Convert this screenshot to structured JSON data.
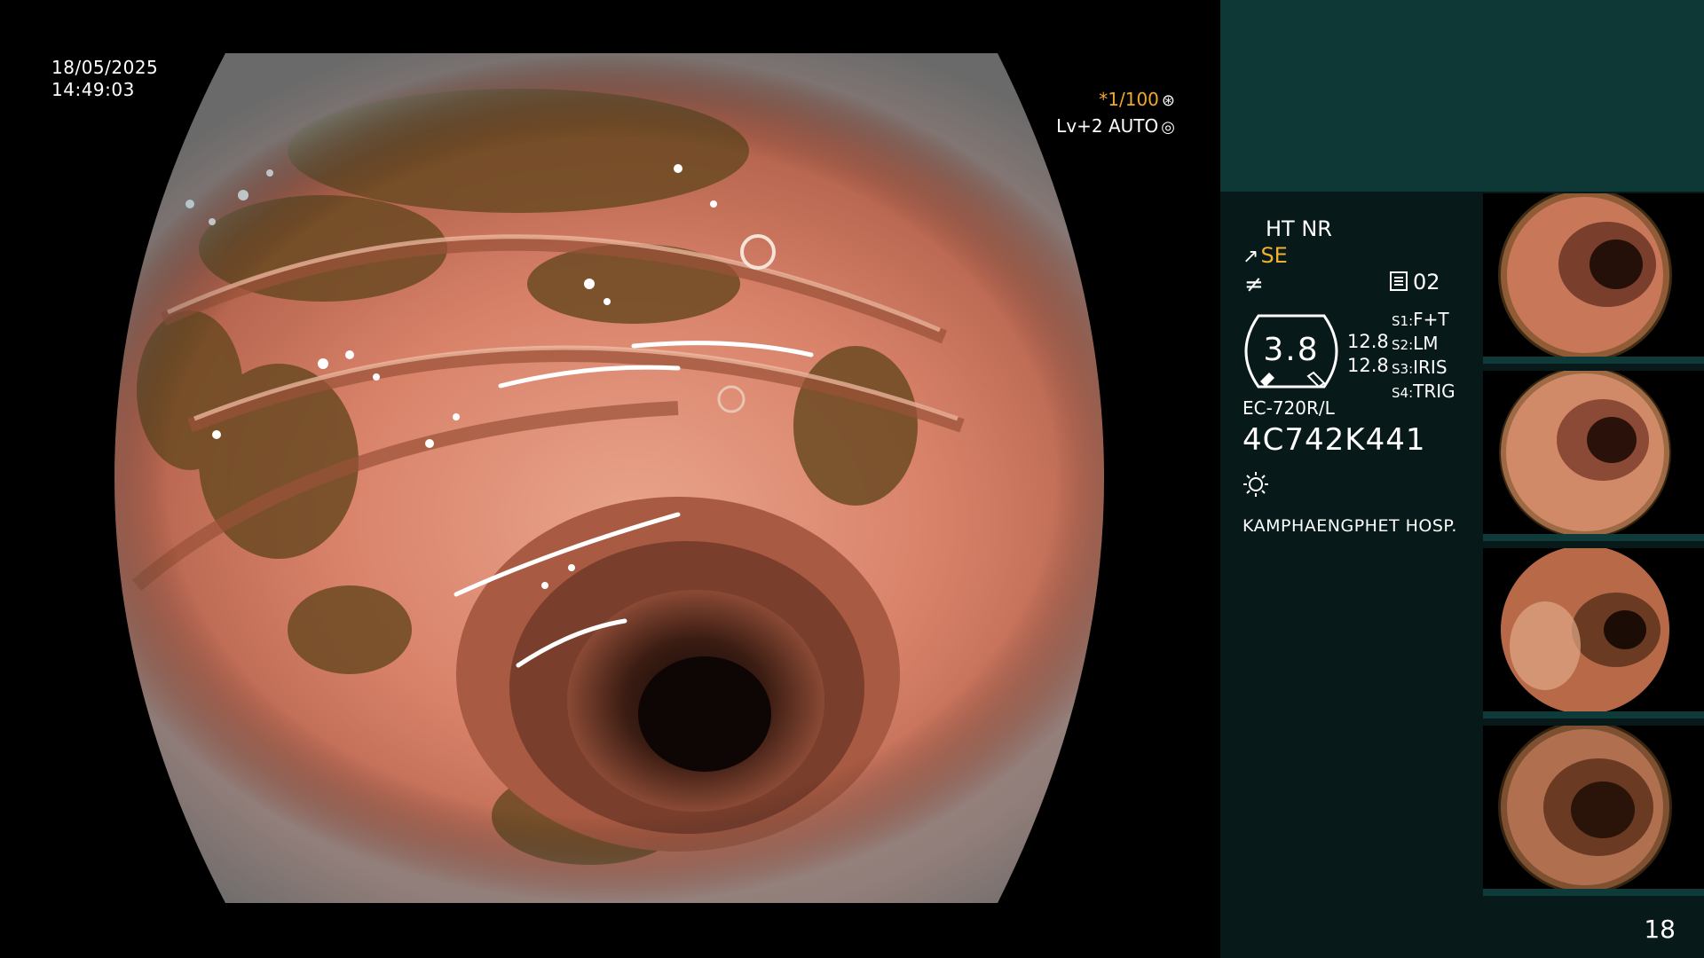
{
  "overlay": {
    "date": "18/05/2025",
    "time": "14:49:03",
    "shutter": "*1/100",
    "shutter_icon": "aperture-icon",
    "level_auto": "Lv+2 AUTO",
    "level_icon": "iris-icon"
  },
  "panel": {
    "ht_nr": "HT NR",
    "se_label": "SE",
    "memo_count": "02",
    "gauge_value": "3.8",
    "gauge_sub": [
      "12.8",
      "12.8"
    ],
    "switches": [
      {
        "key": "S1:",
        "value": "F+T"
      },
      {
        "key": "S2:",
        "value": "LM"
      },
      {
        "key": "S3:",
        "value": "IRIS"
      },
      {
        "key": "S4:",
        "value": "TRIG"
      }
    ],
    "scope_model": "EC-720R/L",
    "scope_serial": "4C742K441",
    "hospital": "KAMPHAENGPHET HOSP."
  },
  "thumbnails": [
    {
      "label": "captured-image-1"
    },
    {
      "label": "captured-image-2"
    },
    {
      "label": "captured-image-3"
    },
    {
      "label": "captured-image-4"
    }
  ],
  "page_number": "18",
  "colors": {
    "panel_top": "#0d3836",
    "panel": "#071a19",
    "accent_orange": "#f0a830",
    "mucosa": "#d9826a"
  }
}
